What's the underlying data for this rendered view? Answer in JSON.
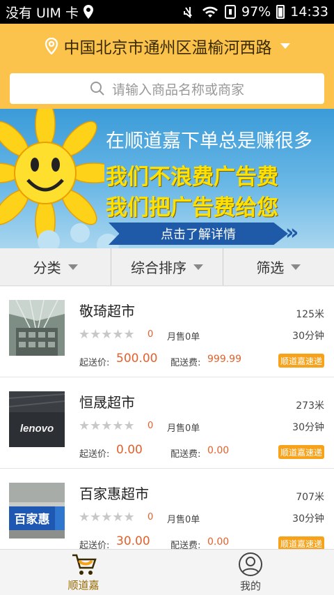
{
  "status_bar": {
    "carrier": "没有 UIM 卡",
    "battery": "97%",
    "time": "14:33"
  },
  "header": {
    "location": "中国北京市通州区温榆河西路",
    "search_placeholder": "请输入商品名称或商家"
  },
  "banner": {
    "line1": "在顺道嘉下单总是赚很多",
    "line2": "我们不浪费广告费",
    "line3": "我们把广告费给您",
    "cta": "点击了解详情"
  },
  "filters": [
    {
      "label": "分类"
    },
    {
      "label": "综合排序"
    },
    {
      "label": "筛选"
    }
  ],
  "stores": [
    {
      "name": "敬琦超市",
      "distance": "125米",
      "rating": "0",
      "sold": "月售0单",
      "time": "30分钟",
      "min_label": "起送价:",
      "min_value": "500.00",
      "fee_label": "配送费:",
      "fee_value": "999.99",
      "badge": "顺道嘉速递"
    },
    {
      "name": "恒晟超市",
      "distance": "273米",
      "rating": "0",
      "sold": "月售0单",
      "time": "30分钟",
      "min_label": "起送价:",
      "min_value": "0.00",
      "fee_label": "配送费:",
      "fee_value": "0.00",
      "badge": "顺道嘉速递"
    },
    {
      "name": "百家惠超市",
      "distance": "707米",
      "rating": "0",
      "sold": "月售0单",
      "time": "30分钟",
      "min_label": "起送价:",
      "min_value": "30.00",
      "fee_label": "配送费:",
      "fee_value": "0.00",
      "badge": "顺道嘉速递"
    }
  ],
  "thumbs": {
    "lenovo_text": "lenovo",
    "baijiahui_text": "百家惠"
  },
  "tabs": [
    {
      "label": "顺道嘉",
      "icon": "cart-icon",
      "active": true
    },
    {
      "label": "我的",
      "icon": "user-icon",
      "active": false
    }
  ],
  "colors": {
    "header_bg": "#fbc34c",
    "accent_orange": "#e4602b",
    "badge_bg": "#f6a21b",
    "banner_blue": "#1e5aa8"
  }
}
